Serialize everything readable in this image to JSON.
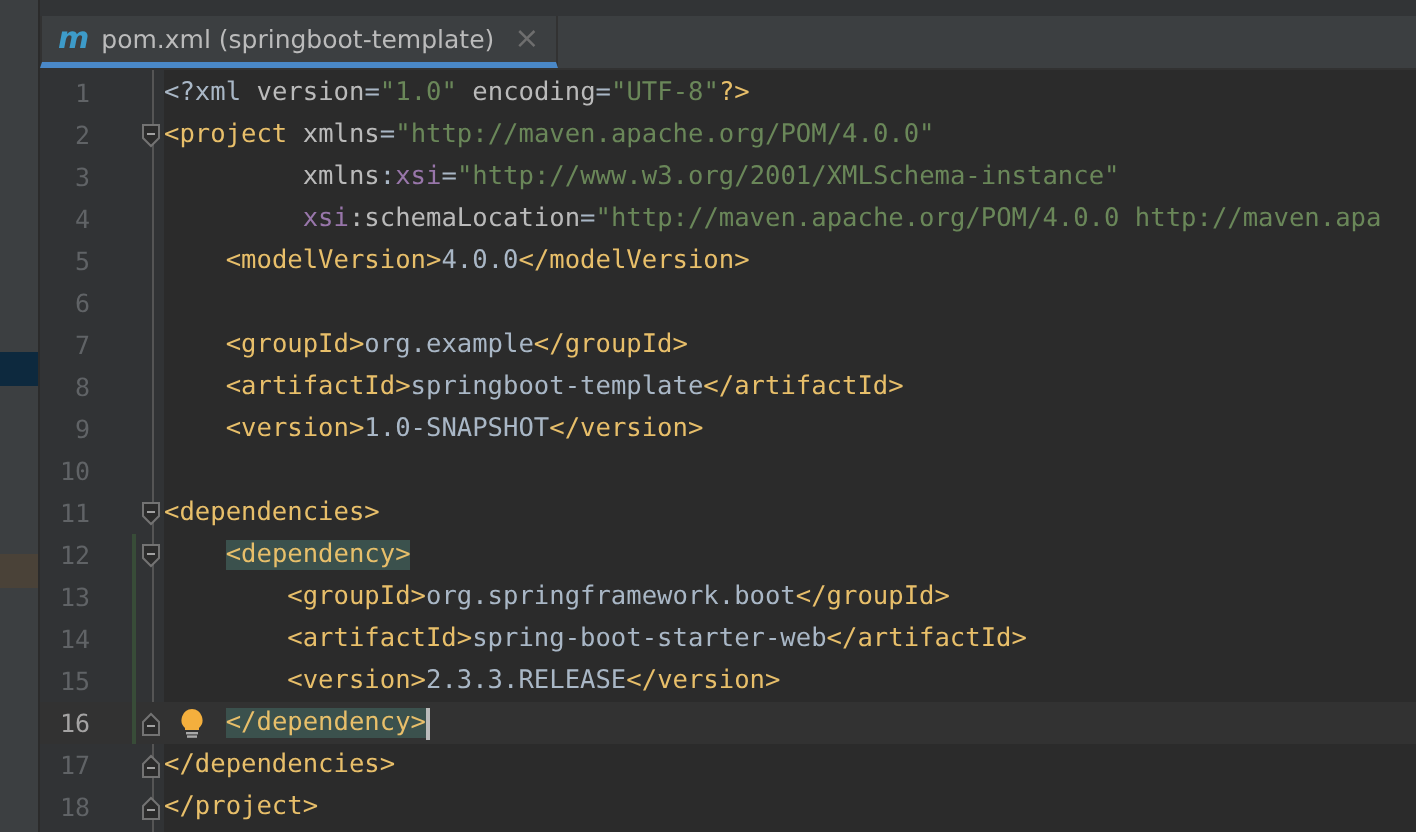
{
  "side_panel": {
    "rows": [
      {
        "kind": "selected"
      },
      {
        "kind": "modified"
      }
    ]
  },
  "tabs": [
    {
      "icon": "m",
      "title": "pom.xml (springboot-template)",
      "close": "×",
      "selected": true
    }
  ],
  "lines": [
    {
      "number": "1",
      "kind": "plain",
      "tokens": [
        {
          "kind": "text",
          "text": "<?xml"
        },
        {
          "kind": "attr",
          "text": " version"
        },
        {
          "kind": "text",
          "text": "="
        },
        {
          "kind": "value",
          "text": "\"1.0\""
        },
        {
          "kind": "attr",
          "text": " encoding"
        },
        {
          "kind": "text",
          "text": "="
        },
        {
          "kind": "value",
          "text": "\"UTF-8\""
        },
        {
          "kind": "tag",
          "text": "?>"
        }
      ]
    },
    {
      "number": "2",
      "kind": "fold_start",
      "tokens": [
        {
          "kind": "tag",
          "text": "<project"
        },
        {
          "kind": "attr",
          "text": " xmlns"
        },
        {
          "kind": "text",
          "text": "="
        },
        {
          "kind": "value",
          "text": "\"http://maven.apache.org/POM/4.0.0\""
        }
      ]
    },
    {
      "number": "3",
      "kind": "plain",
      "tokens": [
        {
          "kind": "attr",
          "text": "         xmlns"
        },
        {
          "kind": "text",
          "text": ":"
        },
        {
          "kind": "ns",
          "text": "xsi"
        },
        {
          "kind": "text",
          "text": "="
        },
        {
          "kind": "value",
          "text": "\"http://www.w3.org/2001/XMLSchema-instance\""
        }
      ]
    },
    {
      "number": "4",
      "kind": "plain",
      "tokens": [
        {
          "kind": "ns",
          "text": "         xsi"
        },
        {
          "kind": "attr",
          "text": ":schemaLocation"
        },
        {
          "kind": "text",
          "text": "="
        },
        {
          "kind": "value",
          "text": "\"http://maven.apache.org/POM/4.0.0 http://maven.apa"
        }
      ]
    },
    {
      "number": "5",
      "kind": "plain",
      "tokens": [
        {
          "kind": "tag",
          "text": "    <modelVersion>"
        },
        {
          "kind": "text",
          "text": "4.0.0"
        },
        {
          "kind": "tag",
          "text": "</modelVersion>"
        }
      ]
    },
    {
      "number": "6",
      "kind": "plain"
    },
    {
      "number": "7",
      "kind": "plain",
      "tokens": [
        {
          "kind": "tag",
          "text": "    <groupId>"
        },
        {
          "kind": "text",
          "text": "org.example"
        },
        {
          "kind": "tag",
          "text": "</groupId>"
        }
      ]
    },
    {
      "number": "8",
      "kind": "plain",
      "tokens": [
        {
          "kind": "tag",
          "text": "    <artifactId>"
        },
        {
          "kind": "text",
          "text": "springboot-template"
        },
        {
          "kind": "tag",
          "text": "</artifactId>"
        }
      ]
    },
    {
      "number": "9",
      "kind": "plain",
      "tokens": [
        {
          "kind": "tag",
          "text": "    <version>"
        },
        {
          "kind": "text",
          "text": "1.0-SNAPSHOT"
        },
        {
          "kind": "tag",
          "text": "</version>"
        }
      ]
    },
    {
      "number": "10",
      "kind": "plain"
    },
    {
      "number": "11",
      "kind": "fold_start",
      "tokens": [
        {
          "kind": "tag",
          "text": "<dependencies>"
        }
      ]
    },
    {
      "number": "12",
      "kind": "fold_start",
      "changed": true,
      "tokens": [
        {
          "kind": "tag",
          "text": "    <dependency>",
          "matched": true
        }
      ]
    },
    {
      "number": "13",
      "kind": "plain",
      "changed": true,
      "tokens": [
        {
          "kind": "tag",
          "text": "        <groupId>"
        },
        {
          "kind": "text",
          "text": "org.springframework.boot"
        },
        {
          "kind": "tag",
          "text": "</groupId>"
        }
      ]
    },
    {
      "number": "14",
      "kind": "plain",
      "changed": true,
      "tokens": [
        {
          "kind": "tag",
          "text": "        <artifactId>"
        },
        {
          "kind": "text",
          "text": "spring-boot-starter-web"
        },
        {
          "kind": "tag",
          "text": "</artifactId>"
        }
      ]
    },
    {
      "number": "15",
      "kind": "plain",
      "changed": true,
      "tokens": [
        {
          "kind": "tag",
          "text": "        <version>"
        },
        {
          "kind": "text",
          "text": "2.3.3.RELEASE"
        },
        {
          "kind": "tag",
          "text": "</version>"
        }
      ]
    },
    {
      "number": "16",
      "kind": "fold_end",
      "changed": true,
      "current": true,
      "bulb": true,
      "tokens": [
        {
          "kind": "tag",
          "text": "    </dependency>",
          "matched": true
        }
      ]
    },
    {
      "number": "17",
      "kind": "fold_end",
      "tokens": [
        {
          "kind": "tag",
          "text": "</dependencies>"
        }
      ]
    },
    {
      "number": "18",
      "kind": "fold_end",
      "tokens": [
        {
          "kind": "tag",
          "text": "</project>"
        }
      ]
    }
  ]
}
